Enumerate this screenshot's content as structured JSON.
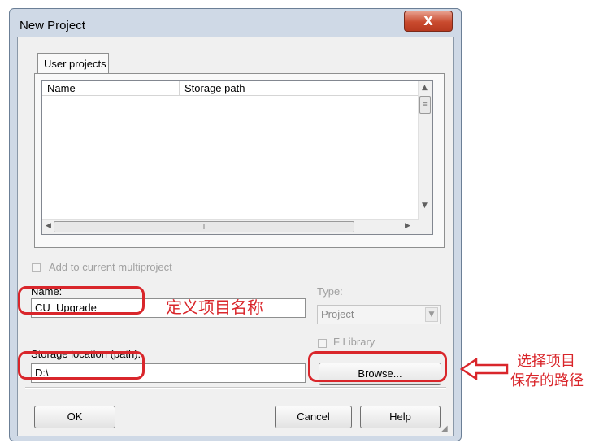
{
  "window": {
    "title": "New Project",
    "close_label": "X"
  },
  "tabs": [
    {
      "label": "User projects"
    }
  ],
  "projects_table": {
    "columns": [
      "Name",
      "Storage path"
    ],
    "rows": [],
    "h_thumb_grip": "III",
    "v_thumb_grip": "≡"
  },
  "add_to_multiproject": {
    "label": "Add to current multiproject",
    "checked": false,
    "enabled": false
  },
  "name": {
    "label": "Name:",
    "value": "CU_Upgrade"
  },
  "type": {
    "label": "Type:",
    "value": "Project",
    "enabled": false
  },
  "f_library": {
    "label": "F Library",
    "checked": false,
    "enabled": false
  },
  "storage": {
    "label": "Storage location (path):",
    "value": "D:\\"
  },
  "buttons": {
    "browse": "Browse...",
    "ok": "OK",
    "cancel": "Cancel",
    "help": "Help"
  },
  "annotations": {
    "name_note": "定义项目名称",
    "browse_note_line1": "选择项目",
    "browse_note_line2": "保存的路径",
    "highlight_color": "#d9262b"
  }
}
